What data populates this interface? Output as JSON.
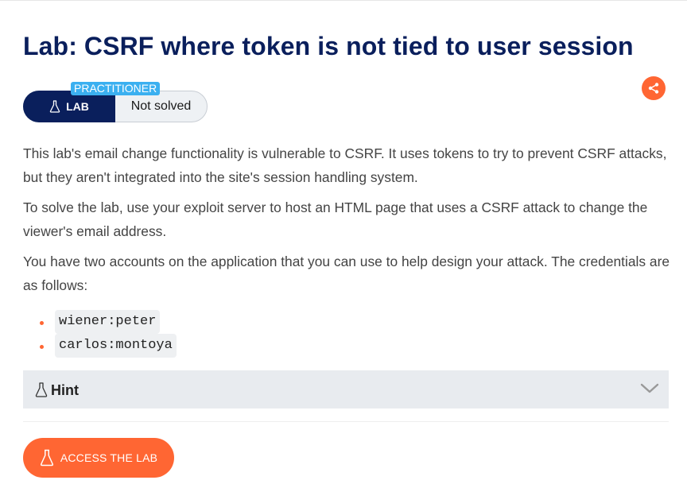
{
  "lab": {
    "title": "Lab: CSRF where token is not tied to user session",
    "level": "PRACTITIONER",
    "tag": "LAB",
    "status": "Not solved"
  },
  "description": [
    "This lab's email change functionality is vulnerable to CSRF. It uses tokens to try to prevent CSRF attacks, but they aren't integrated into the site's session handling system.",
    "To solve the lab, use your exploit server to host an HTML page that uses a CSRF attack to change the viewer's email address.",
    "You have two accounts on the application that you can use to help design your attack. The credentials are as follows:"
  ],
  "credentials": [
    "wiener:peter",
    "carlos:montoya"
  ],
  "hint": {
    "label": "Hint",
    "icon": "flask-icon",
    "toggle_icon": "chevron-down-icon"
  },
  "access_button": {
    "label": "ACCESS THE LAB",
    "icon": "flask-icon"
  },
  "share_icon": "share-icon",
  "colors": {
    "title": "#0a1f5c",
    "accent": "#ff6633",
    "level_badge": "#3bb0f0",
    "hint_bg": "#e8ebef"
  }
}
